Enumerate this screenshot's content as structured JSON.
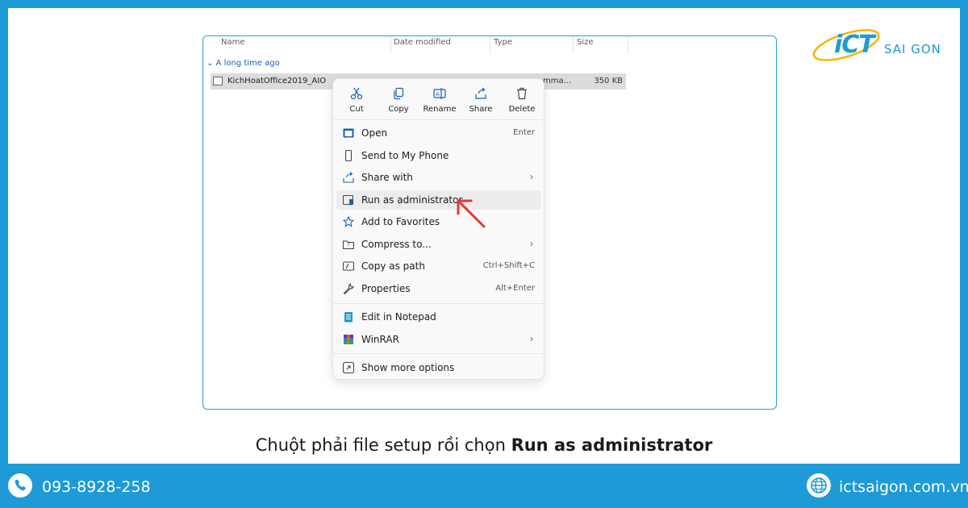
{
  "logo": {
    "brand": "iCT",
    "sub": "SAI GON"
  },
  "explorer": {
    "columns": [
      "Name",
      "Date modified",
      "Type",
      "Size"
    ],
    "group_header": "A long time ago",
    "file": {
      "name": "KichHoatOffice2019_AIO",
      "type_partial": "mma...",
      "size": "350 KB"
    }
  },
  "context_menu": {
    "quick_actions": [
      {
        "label": "Cut",
        "icon": "scissors-icon"
      },
      {
        "label": "Copy",
        "icon": "copy-icon"
      },
      {
        "label": "Rename",
        "icon": "rename-icon"
      },
      {
        "label": "Share",
        "icon": "share-icon"
      },
      {
        "label": "Delete",
        "icon": "trash-icon"
      }
    ],
    "items": [
      {
        "label": "Open",
        "shortcut": "Enter"
      },
      {
        "label": "Send to My Phone",
        "shortcut": ""
      },
      {
        "label": "Share with",
        "shortcut": ""
      },
      {
        "label": "Run as administrator",
        "shortcut": "",
        "highlighted": true
      },
      {
        "label": "Add to Favorites",
        "shortcut": ""
      },
      {
        "label": "Compress to...",
        "shortcut": ""
      },
      {
        "label": "Copy as path",
        "shortcut": "Ctrl+Shift+C"
      },
      {
        "label": "Properties",
        "shortcut": "Alt+Enter"
      },
      {
        "label": "Edit in Notepad",
        "shortcut": ""
      },
      {
        "label": "WinRAR",
        "shortcut": ""
      },
      {
        "label": "Show more options",
        "shortcut": ""
      }
    ]
  },
  "caption": {
    "prefix": "Chuột phải file setup rồi chọn ",
    "bold": "Run as administrator"
  },
  "footer": {
    "phone": "093-8928-258",
    "website": "ictsaigon.com.vn"
  },
  "colors": {
    "brand": "#1e9ad6",
    "arrow": "#e53935"
  }
}
